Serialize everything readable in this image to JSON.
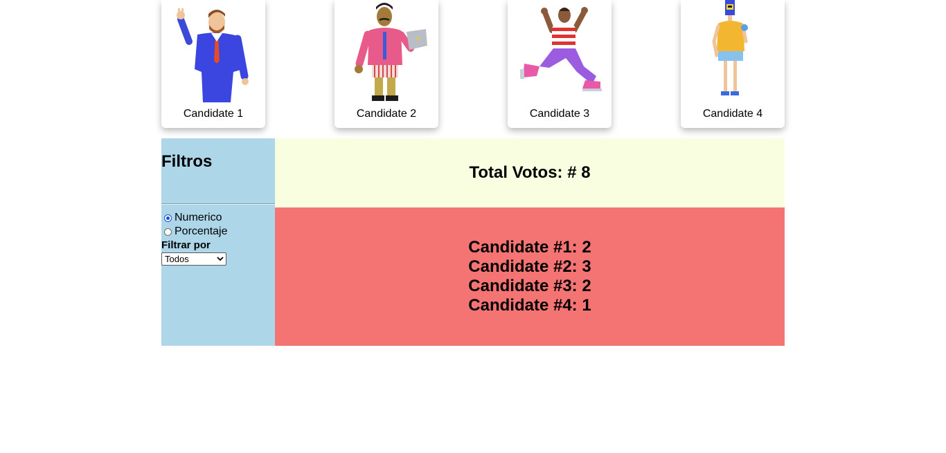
{
  "candidates": [
    {
      "label": "Candidate 1",
      "figure": "man-in-blue-suit-peace-sign"
    },
    {
      "label": "Candidate 2",
      "figure": "man-with-laptop-pink-shirt"
    },
    {
      "label": "Candidate 3",
      "figure": "running-person-striped-shirt"
    },
    {
      "label": "Candidate 4",
      "figure": "robot-head-yellow-shirt"
    }
  ],
  "filters": {
    "title": "Filtros",
    "options": [
      "Numerico",
      "Porcentaje"
    ],
    "selected_option": "Numerico",
    "filter_by_label": "Filtrar por",
    "filter_by_value": "Todos"
  },
  "summary": {
    "total_text": "Total Votos: # 8"
  },
  "results": [
    "Candidate #1: 2",
    "Candidate #2: 3",
    "Candidate #3: 2",
    "Candidate #4: 1"
  ],
  "colors": {
    "filters_bg": "#add6e9",
    "total_bg": "#fafee0",
    "results_bg": "#f47474"
  }
}
